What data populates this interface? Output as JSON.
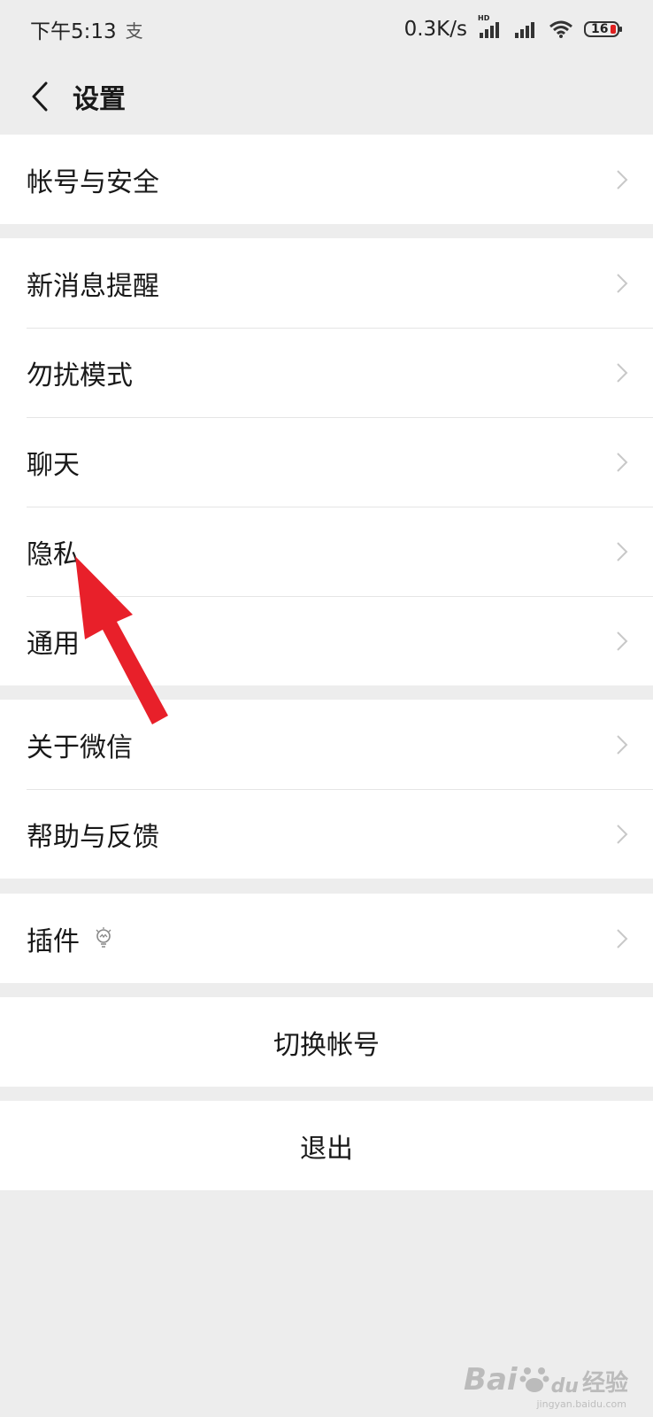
{
  "status_bar": {
    "time": "下午5:13",
    "pay_icon": "支",
    "speed": "0.3K/s",
    "hd_label": "HD",
    "battery": "16",
    "icons": [
      "signal-hd-icon",
      "signal-icon",
      "wifi-icon",
      "battery-icon"
    ]
  },
  "header": {
    "back_icon": "chevron-left-icon",
    "title": "设置"
  },
  "groups": [
    {
      "items": [
        {
          "label": "帐号与安全"
        }
      ]
    },
    {
      "items": [
        {
          "label": "新消息提醒"
        },
        {
          "label": "勿扰模式"
        },
        {
          "label": "聊天"
        },
        {
          "label": "隐私"
        },
        {
          "label": "通用"
        }
      ]
    },
    {
      "items": [
        {
          "label": "关于微信"
        },
        {
          "label": "帮助与反馈"
        }
      ]
    },
    {
      "items": [
        {
          "label": "插件",
          "icon": "lightbulb-icon"
        }
      ]
    }
  ],
  "actions": {
    "switch_account": "切换帐号",
    "logout": "退出"
  },
  "annotation": {
    "type": "red-arrow",
    "points_to": "隐私",
    "color": "#e8202a"
  },
  "watermark": {
    "logo": "Bai",
    "logo_paw": "du",
    "text": "经验",
    "url": "jingyan.baidu.com"
  },
  "colors": {
    "background": "#ededed",
    "cell": "#ffffff",
    "divider": "#e5e5e5",
    "text": "#191919",
    "chevron": "#c8c8c8"
  }
}
